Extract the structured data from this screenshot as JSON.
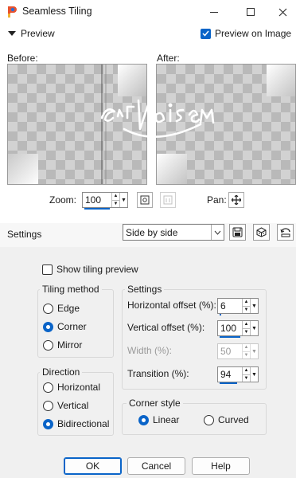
{
  "window": {
    "title": "Seamless Tiling",
    "controls": {
      "minimize": "—",
      "maximize": "☐",
      "close": "✕"
    }
  },
  "preview": {
    "section_label": "Preview",
    "preview_on_image_label": "Preview on Image",
    "preview_on_image_checked": true,
    "before_label": "Before:",
    "after_label": "After:",
    "watermark": "ArtNaisem",
    "zoom_label": "Zoom:",
    "zoom_value": "100",
    "pan_label": "Pan:"
  },
  "presets": {
    "label": "Settings",
    "selected": "Side by side",
    "icons": [
      "save-preset-icon",
      "randomize-icon",
      "reset-icon"
    ]
  },
  "options": {
    "show_tiling_preview_label": "Show tiling preview",
    "show_tiling_preview_checked": false
  },
  "tiling_method": {
    "title": "Tiling method",
    "options": [
      "Edge",
      "Corner",
      "Mirror"
    ],
    "selected": "Corner"
  },
  "direction": {
    "title": "Direction",
    "options": [
      "Horizontal",
      "Vertical",
      "Bidirectional"
    ],
    "selected": "Bidirectional"
  },
  "settings": {
    "title": "Settings",
    "horizontal_offset": {
      "label": "Horizontal offset (%):",
      "value": "6"
    },
    "vertical_offset": {
      "label": "Vertical offset (%):",
      "value": "100"
    },
    "width": {
      "label": "Width (%):",
      "value": "50",
      "disabled": true
    },
    "transition": {
      "label": "Transition (%):",
      "value": "94"
    }
  },
  "corner_style": {
    "title": "Corner style",
    "options": [
      "Linear",
      "Curved"
    ],
    "selected": "Linear"
  },
  "buttons": {
    "ok": "OK",
    "cancel": "Cancel",
    "help": "Help"
  },
  "colors": {
    "accent": "#0a64c8"
  }
}
